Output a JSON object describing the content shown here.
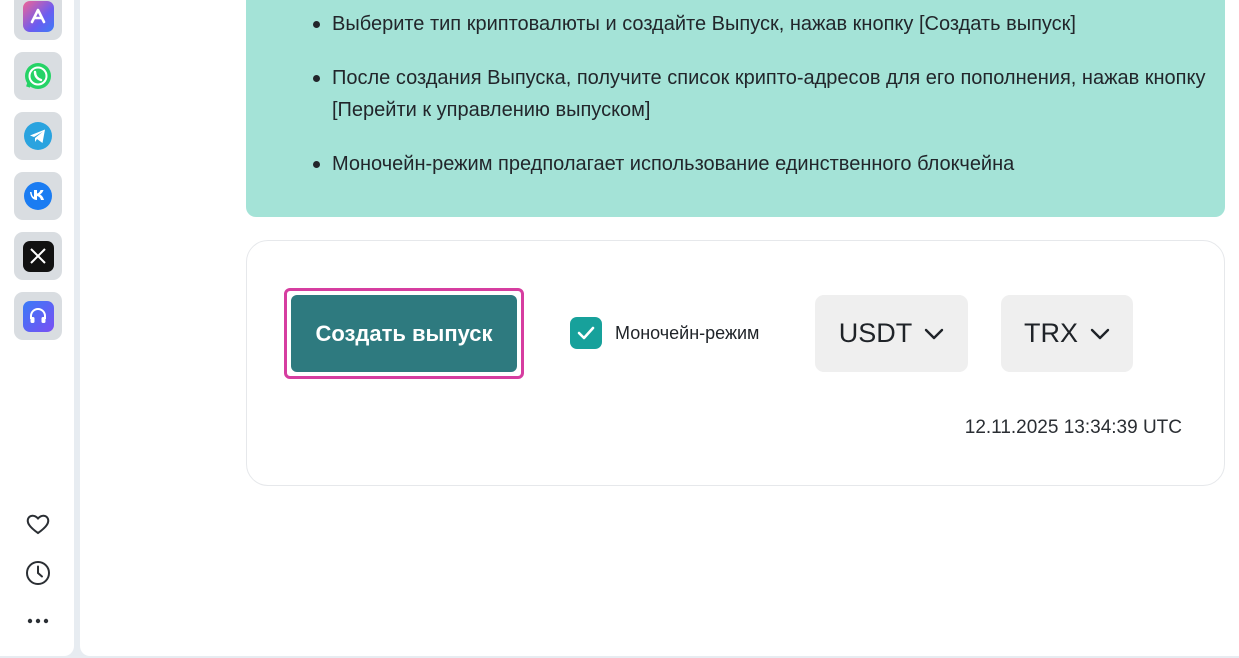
{
  "sidebar": {
    "apps": [
      {
        "name": "app-a-icon",
        "color": "#6b5cf0"
      },
      {
        "name": "whatsapp-icon",
        "color": "#25d366"
      },
      {
        "name": "telegram-icon",
        "color": "#2aa3df"
      },
      {
        "name": "vk-icon",
        "color": "#1a7cf2"
      },
      {
        "name": "x-icon",
        "color": "#111111"
      },
      {
        "name": "headphones-icon",
        "color": "#6a5cf5"
      }
    ],
    "tools": [
      "heart-icon",
      "clock-icon",
      "more-icon"
    ]
  },
  "info": {
    "items": [
      "Выберите тип криптовалюты и создайте Выпуск, нажав кнопку [Создать выпуск]",
      "После создания Выпуска, получите список крипто-адресов для его пополнения, нажав кнопку [Перейти к управлению выпуском]",
      "Моночейн-режим предполагает использование единственного блокчейна"
    ],
    "background": "#a4e3d7"
  },
  "form": {
    "create_button": "Создать выпуск",
    "mono_label": "Моночейн-режим",
    "mono_checked": true,
    "currency": "USDT",
    "network": "TRX",
    "timestamp": "12.11.2025 13:34:39 UTC",
    "accent": "#2e7a7f",
    "highlight": "#d63da0"
  }
}
